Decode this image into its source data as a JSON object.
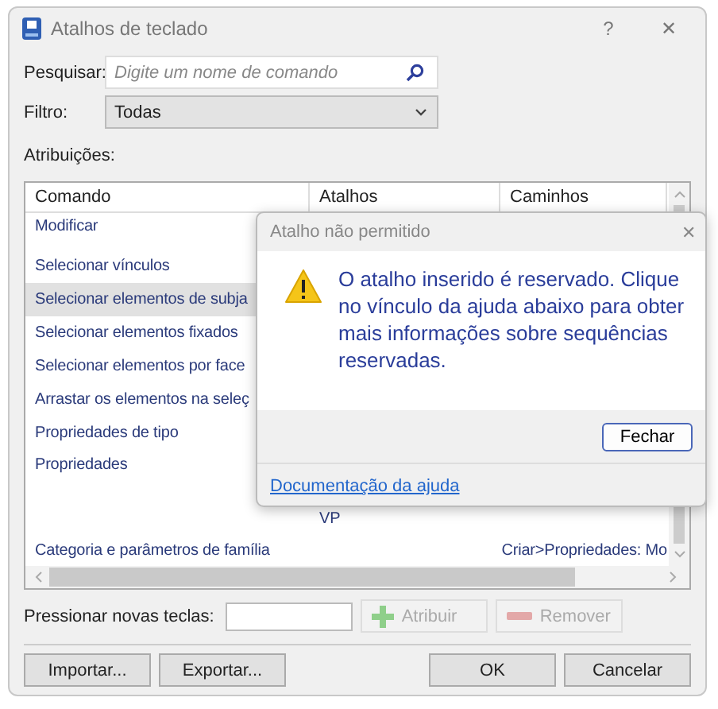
{
  "window": {
    "title": "Atalhos de teclado",
    "help": "?",
    "close": "✕"
  },
  "search": {
    "label": "Pesquisar:",
    "placeholder": "Digite um nome de comando"
  },
  "filter": {
    "label": "Filtro:",
    "value": "Todas"
  },
  "assignments": {
    "label": "Atribuições:",
    "columns": [
      "Comando",
      "Atalhos",
      "Caminhos"
    ],
    "rows": [
      {
        "command": "Modificar",
        "selected": false
      },
      {
        "command": "Selecionar vínculos",
        "selected": false
      },
      {
        "command": "Selecionar elementos de subja",
        "selected": true
      },
      {
        "command": "Selecionar elementos fixados",
        "selected": false
      },
      {
        "command": "Selecionar elementos por face",
        "selected": false
      },
      {
        "command": "Arrastar os elementos na seleç",
        "selected": false
      },
      {
        "command": "Propriedades de tipo",
        "selected": false
      },
      {
        "command": "Propriedades",
        "selected": false
      },
      {
        "shortcut": "VP",
        "selected": false
      },
      {
        "command": "Categoria e parâmetros de família",
        "path": "Criar>Propriedades: Mo",
        "selected": false
      }
    ]
  },
  "new_keys": {
    "label": "Pressionar novas teclas:",
    "assign": {
      "label": "Atribuir",
      "disabled": true
    },
    "remove": {
      "label": "Remover",
      "disabled": true
    }
  },
  "buttons": [
    "Importar...",
    "Exportar...",
    "OK",
    "Cancelar"
  ],
  "alert": {
    "title": "Atalho não permitido",
    "close": "✕",
    "message": "O atalho inserido é reservado. Clique no vínculo da ajuda abaixo para obter mais informações sobre sequências reservadas.",
    "button": "Fechar",
    "link": "Documentação da ajuda"
  }
}
